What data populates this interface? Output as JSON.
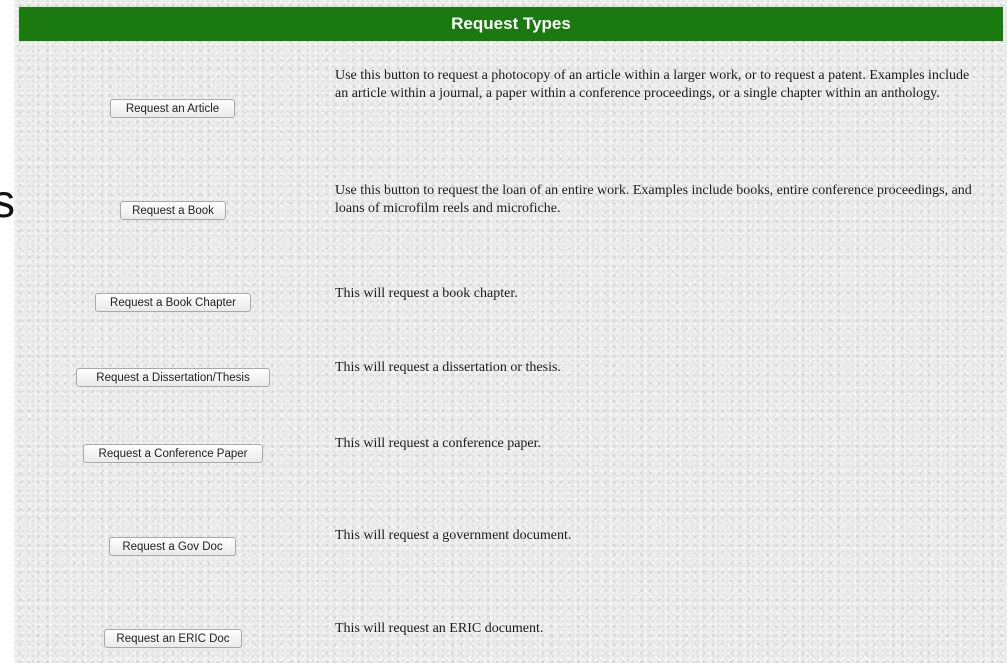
{
  "header": {
    "title": "Request Types"
  },
  "edge_fragment": "s",
  "rows": [
    {
      "button_label": "Request an Article",
      "description": "Use this button to request a photocopy of an article within a larger work, or to request a patent. Examples include an article within a journal, a paper  within a conference proceedings, or a single chapter within an anthology."
    },
    {
      "button_label": "Request a Book",
      "description": "Use this button to request the loan of an entire work. Examples include books, entire conference proceedings, and loans of microfilm reels and microfiche."
    },
    {
      "button_label": "Request a Book Chapter",
      "description": "This will request a book chapter."
    },
    {
      "button_label": "Request a Dissertation/Thesis",
      "description": "This will request a dissertation or thesis."
    },
    {
      "button_label": "Request a Conference Paper",
      "description": "This will request a conference paper."
    },
    {
      "button_label": "Request a Gov Doc",
      "description": "This will request a government document."
    },
    {
      "button_label": "Request an ERIC Doc",
      "description": "This will request an ERIC document."
    }
  ]
}
